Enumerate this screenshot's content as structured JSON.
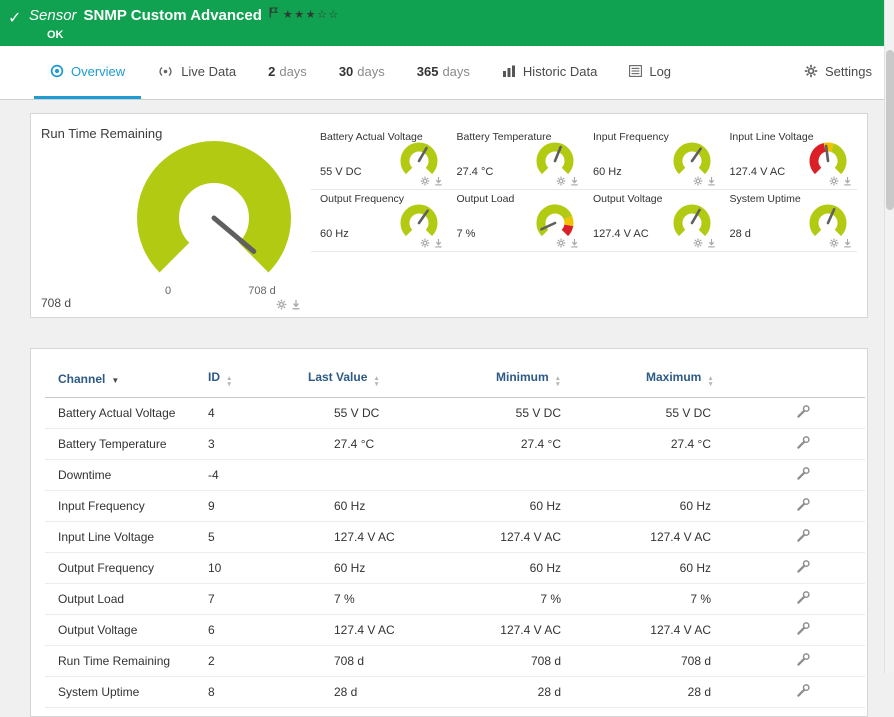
{
  "colors": {
    "brand_green": "#10a251",
    "lime": "#b3ca12",
    "active_blue": "#1d9bd4",
    "red": "#da1f26",
    "yellow": "#f0c300",
    "needle": "#5f5f5f",
    "table_header": "#2d5a86"
  },
  "header": {
    "type_label": "Sensor",
    "title": "SNMP Custom Advanced",
    "status": "OK",
    "stars_filled": 3,
    "stars_total": 5
  },
  "tabs": [
    {
      "id": "overview",
      "label": "Overview",
      "icon": "overview-icon",
      "active": true
    },
    {
      "id": "live-data",
      "label": "Live Data",
      "icon": "live-data-icon",
      "active": false
    },
    {
      "id": "2-days",
      "num": "2",
      "label": "days",
      "active": false
    },
    {
      "id": "30-days",
      "num": "30",
      "label": "days",
      "active": false
    },
    {
      "id": "365-days",
      "num": "365",
      "label": "days",
      "active": false
    },
    {
      "id": "historic-data",
      "label": "Historic Data",
      "icon": "historic-data-icon",
      "active": false
    },
    {
      "id": "log",
      "label": "Log",
      "icon": "log-icon",
      "active": false
    },
    {
      "id": "settings",
      "label": "Settings",
      "icon": "settings-icon",
      "active": false
    }
  ],
  "main_gauge": {
    "title": "Run Time Remaining",
    "value": "708 d",
    "min_label": "0",
    "max_label": "708 d",
    "needle_deg": -40,
    "segments": [
      {
        "color": "lime",
        "from": 0,
        "to": 1
      }
    ]
  },
  "small_gauges": [
    {
      "title": "Battery Actual Voltage",
      "value": "55 V DC",
      "needle_deg": 60,
      "segments": [
        {
          "color": "lime",
          "from": 0,
          "to": 1
        }
      ]
    },
    {
      "title": "Battery Temperature",
      "value": "27.4 °C",
      "needle_deg": 68,
      "segments": [
        {
          "color": "lime",
          "from": 0,
          "to": 1
        }
      ]
    },
    {
      "title": "Input Frequency",
      "value": "60 Hz",
      "needle_deg": 55,
      "segments": [
        {
          "color": "lime",
          "from": 0,
          "to": 1
        }
      ]
    },
    {
      "title": "Input Line Voltage",
      "value": "127.4 V AC",
      "needle_deg": 97,
      "segments": [
        {
          "color": "red",
          "from": 0,
          "to": 0.45
        },
        {
          "color": "yellow",
          "from": 0.45,
          "to": 0.57
        },
        {
          "color": "lime",
          "from": 0.57,
          "to": 1
        }
      ]
    },
    {
      "title": "Output Frequency",
      "value": "60 Hz",
      "needle_deg": 55,
      "segments": [
        {
          "color": "lime",
          "from": 0,
          "to": 1
        }
      ]
    },
    {
      "title": "Output Load",
      "value": "7 %",
      "needle_deg": 205,
      "segments": [
        {
          "color": "lime",
          "from": 0,
          "to": 0.75
        },
        {
          "color": "yellow",
          "from": 0.75,
          "to": 0.87
        },
        {
          "color": "red",
          "from": 0.87,
          "to": 1
        }
      ]
    },
    {
      "title": "Output Voltage",
      "value": "127.4 V AC",
      "needle_deg": 60,
      "segments": [
        {
          "color": "lime",
          "from": 0,
          "to": 1
        }
      ]
    },
    {
      "title": "System Uptime",
      "value": "28 d",
      "needle_deg": 66,
      "segments": [
        {
          "color": "lime",
          "from": 0,
          "to": 1
        }
      ]
    }
  ],
  "table": {
    "columns": [
      {
        "label": "Channel",
        "sort": "desc"
      },
      {
        "label": "ID",
        "sort": "both"
      },
      {
        "label": "Last Value",
        "sort": "both"
      },
      {
        "label": "Minimum",
        "sort": "both"
      },
      {
        "label": "Maximum",
        "sort": "both"
      }
    ],
    "row_action_icon": "channel-settings-icon",
    "rows": [
      {
        "channel": "Battery Actual Voltage",
        "id": "4",
        "last": "55 V DC",
        "min": "55 V DC",
        "max": "55 V DC"
      },
      {
        "channel": "Battery Temperature",
        "id": "3",
        "last": "27.4 °C",
        "min": "27.4 °C",
        "max": "27.4 °C"
      },
      {
        "channel": "Downtime",
        "id": "-4",
        "last": "",
        "min": "",
        "max": ""
      },
      {
        "channel": "Input Frequency",
        "id": "9",
        "last": "60 Hz",
        "min": "60 Hz",
        "max": "60 Hz"
      },
      {
        "channel": "Input Line Voltage",
        "id": "5",
        "last": "127.4 V AC",
        "min": "127.4 V AC",
        "max": "127.4 V AC"
      },
      {
        "channel": "Output Frequency",
        "id": "10",
        "last": "60 Hz",
        "min": "60 Hz",
        "max": "60 Hz"
      },
      {
        "channel": "Output Load",
        "id": "7",
        "last": "7 %",
        "min": "7 %",
        "max": "7 %"
      },
      {
        "channel": "Output Voltage",
        "id": "6",
        "last": "127.4 V AC",
        "min": "127.4 V AC",
        "max": "127.4 V AC"
      },
      {
        "channel": "Run Time Remaining",
        "id": "2",
        "last": "708 d",
        "min": "708 d",
        "max": "708 d"
      },
      {
        "channel": "System Uptime",
        "id": "8",
        "last": "28 d",
        "min": "28 d",
        "max": "28 d"
      }
    ]
  }
}
